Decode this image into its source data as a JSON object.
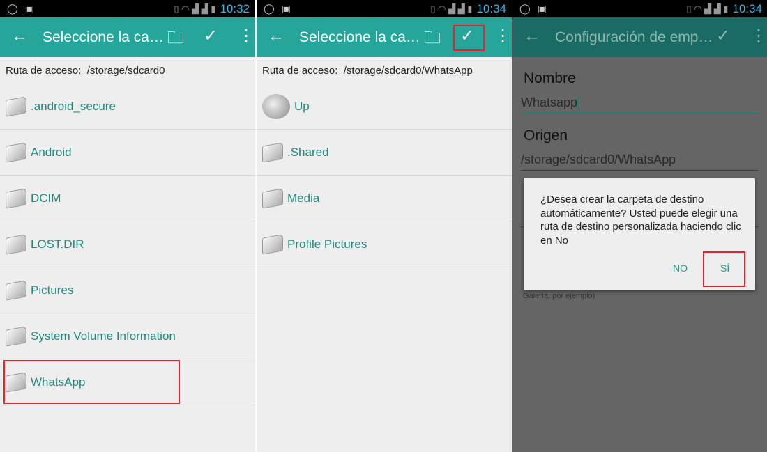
{
  "colors": {
    "accent": "#26a69a",
    "highlight": "#e8212b"
  },
  "panels": [
    {
      "time": "10:32",
      "title": "Seleccione la ca…",
      "path_label": "Ruta de acceso:",
      "path": "/storage/sdcard0",
      "items": [
        ".android_secure",
        "Android",
        "DCIM",
        "LOST.DIR",
        "Pictures",
        "System Volume Information",
        "WhatsApp"
      ]
    },
    {
      "time": "10:34",
      "title": "Seleccione la ca…",
      "path_label": "Ruta de acceso:",
      "path": "/storage/sdcard0/WhatsApp",
      "items": [
        "Up",
        ".Shared",
        "Media",
        "Profile Pictures"
      ]
    },
    {
      "time": "10:34",
      "title": "Configuración de emp…",
      "nombre_label": "Nombre",
      "nombre_value": "Whatsapp",
      "origen_label": "Origen",
      "origen_value": "/storage/sdcard0/WhatsApp",
      "hint": "Galería, por ejemplo)",
      "dialog": {
        "message": "¿Desea crear la carpeta de destino automáticamente? Usted puede elegir una ruta de destino personalizada haciendo clic en No",
        "no": "NO",
        "yes": "SÍ"
      }
    }
  ]
}
